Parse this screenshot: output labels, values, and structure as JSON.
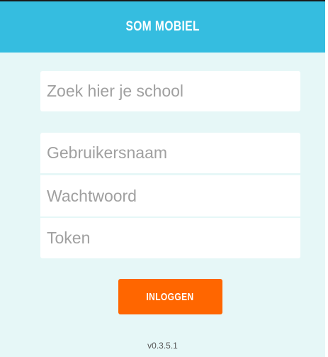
{
  "header": {
    "title": "SOM MOBIEL"
  },
  "form": {
    "school_placeholder": "Zoek hier je school",
    "username_placeholder": "Gebruikersnaam",
    "password_placeholder": "Wachtwoord",
    "token_placeholder": "Token",
    "login_label": "INLOGGEN"
  },
  "footer": {
    "version": "v0.3.5.1"
  },
  "colors": {
    "header": "#35bde0",
    "background": "#e6f7f7",
    "button": "#ff6600"
  }
}
